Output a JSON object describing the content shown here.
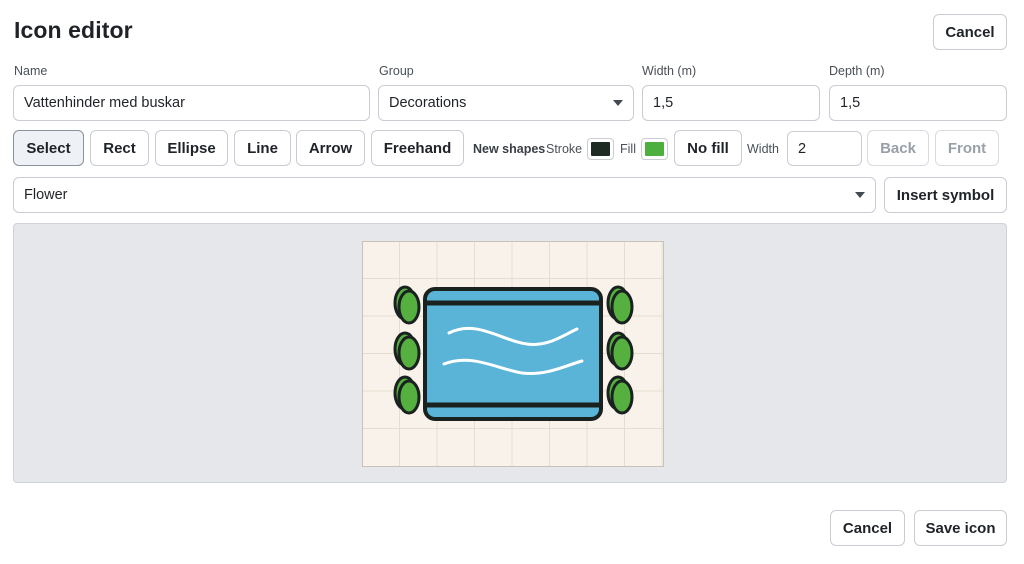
{
  "dialog": {
    "title": "Icon editor",
    "cancel_top": "Cancel"
  },
  "fields": {
    "name_label": "Name",
    "name_value": "Vattenhinder med buskar",
    "group_label": "Group",
    "group_value": "Decorations",
    "width_label": "Width (m)",
    "width_value": "1,5",
    "depth_label": "Depth (m)",
    "depth_value": "1,5"
  },
  "toolbar": {
    "tools": [
      "Select",
      "Rect",
      "Ellipse",
      "Line",
      "Arrow",
      "Freehand"
    ],
    "active_tool": "Select",
    "new_shapes_label": "New shapes",
    "stroke_label": "Stroke",
    "stroke_color": "#1e2a24",
    "fill_label": "Fill",
    "fill_color": "#4caf3e",
    "no_fill_label": "No fill",
    "width_label": "Width",
    "width_value": "2",
    "back_label": "Back",
    "front_label": "Front"
  },
  "symbol": {
    "selected": "Flower",
    "insert_label": "Insert symbol"
  },
  "colors": {
    "water": "#5ab4d8",
    "outline": "#1a2220",
    "bush": "#55b040",
    "canvas_bg": "#f8f2ea",
    "grid": "#e5ddd0"
  },
  "footer": {
    "cancel_label": "Cancel",
    "save_label": "Save icon"
  }
}
